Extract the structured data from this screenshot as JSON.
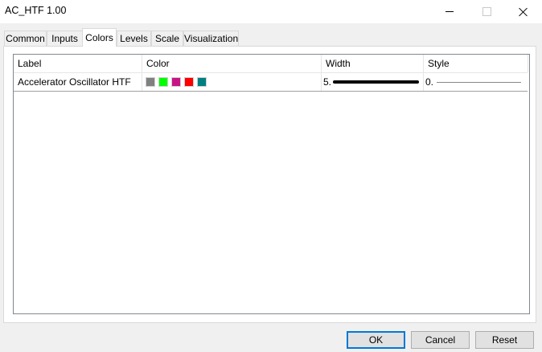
{
  "window": {
    "title": "AC_HTF 1.00"
  },
  "tabs": [
    {
      "label": "Common"
    },
    {
      "label": "Inputs"
    },
    {
      "label": "Colors"
    },
    {
      "label": "Levels"
    },
    {
      "label": "Scale"
    },
    {
      "label": "Visualization"
    }
  ],
  "active_tab": "Colors",
  "table": {
    "columns": [
      "Label",
      "Color",
      "Width",
      "Style"
    ],
    "rows": [
      {
        "label": "Accelerator Oscillator  HTF",
        "colors": [
          "#808080",
          "#00ff00",
          "#c71585",
          "#ff0000",
          "#008080"
        ],
        "width": "5.",
        "style": "0."
      }
    ]
  },
  "buttons": {
    "ok": "OK",
    "cancel": "Cancel",
    "reset": "Reset"
  }
}
